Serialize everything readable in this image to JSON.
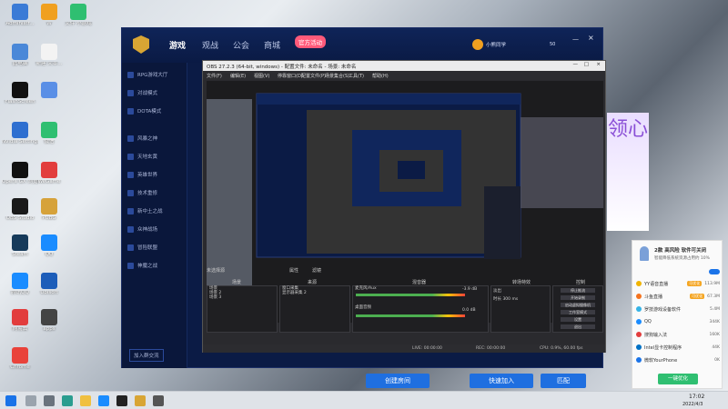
{
  "desktop": {
    "icons": [
      {
        "label": "Administr...",
        "icon": "computer-icon",
        "color": "#3b7bd6"
      },
      {
        "label": "W",
        "icon": "owl-icon",
        "color": "#f0a020"
      },
      {
        "label": "文件 小游戏",
        "icon": "wechat-icon",
        "color": "#2fbf71"
      },
      {
        "label": "此电脑",
        "icon": "pc-icon",
        "color": "#4a88d8"
      },
      {
        "label": "新建 文本...",
        "icon": "document-icon",
        "color": "#f3f3f3"
      },
      {
        "label": "FlashScreen",
        "icon": "screen-icon",
        "color": "#111111"
      },
      {
        "label": "",
        "icon": "folder-icon",
        "color": "#5a8fe6"
      },
      {
        "label": "Nvidia Settings",
        "icon": "nvidia-icon",
        "color": "#2e6fd0"
      },
      {
        "label": "微信",
        "icon": "wechat-green-icon",
        "color": "#2fbf71"
      },
      {
        "label": "Opera GX 浏览器",
        "icon": "opera-icon",
        "color": "#111111"
      },
      {
        "label": "WeGame",
        "icon": "wegame-icon",
        "color": "#e23d3d"
      },
      {
        "label": "OBS Studio",
        "icon": "obs-icon",
        "color": "#1a1a1a"
      },
      {
        "label": "PUBG",
        "icon": "pubg-icon",
        "color": "#d6a23a"
      },
      {
        "label": "Steam",
        "icon": "steam-icon",
        "color": "#163a5a"
      },
      {
        "label": "QQ",
        "icon": "qq-icon",
        "color": "#1a8cff"
      },
      {
        "label": "腾讯QQ",
        "icon": "qq2-icon",
        "color": "#1a8cff"
      },
      {
        "label": "Ubisoft",
        "icon": "ubisoft-icon",
        "color": "#1c5db9"
      },
      {
        "label": "网易云",
        "icon": "music-icon",
        "color": "#e23d3d"
      },
      {
        "label": "apps",
        "icon": "app-icon",
        "color": "#444444"
      },
      {
        "label": "Chrome",
        "icon": "chrome-icon",
        "color": "#e9423a"
      }
    ]
  },
  "game_client": {
    "logo": "game-logo-icon",
    "nav": [
      "游戏",
      "观战",
      "公会",
      "商城"
    ],
    "badge": "官方活动",
    "user": "小熊同学",
    "coins": "50",
    "sidebar": [
      "RPG游戏大厅",
      "对战模式",
      "DOTA模式",
      "风暴之神",
      "天地玄黄",
      "英雄世界",
      "技术重修",
      "新中土之战",
      "众神战场",
      "冒险联盟",
      "神魔之战"
    ],
    "bottom_tag": "加入群交流",
    "buttons": [
      "创建房间",
      "快速加入",
      "匹配"
    ]
  },
  "obs": {
    "title": "OBS 27.2.3 (64-bit, windows) - 配置文件: 未命名 - 场景: 未命名",
    "menu": [
      "文件(F)",
      "编辑(E)",
      "视图(V)",
      "停靠窗口(D)",
      "配置文件(P)",
      "场景集合(S)",
      "工具(T)",
      "帮助(H)"
    ],
    "toolbar": {
      "label": "未选择源",
      "props": "属性",
      "filters": "滤镜"
    },
    "docks": {
      "scenes": "场景",
      "sources": "来源",
      "mixer": "混音器",
      "transitions": "转场特效",
      "controls": "控制"
    },
    "scenes": [
      "场景",
      "场景 2",
      "场景 3"
    ],
    "sources": [
      "窗口采集",
      "显示器采集 2"
    ],
    "mixer": [
      {
        "name": "桌面音频",
        "db": "0.0 dB"
      },
      {
        "name": "麦克风/Aux",
        "db": "-3.9 dB"
      }
    ],
    "transitions": {
      "type": "淡出",
      "duration_label": "时长",
      "duration": "300 ms"
    },
    "controls": [
      "停止推流",
      "开始录制",
      "启动虚拟摄像机",
      "工作室模式",
      "设置",
      "退出"
    ],
    "status": {
      "live": "LIVE: 00:00:00",
      "rec": "REC: 00:00:00",
      "cpu": "CPU: 0.9%, 60.00 fps"
    }
  },
  "ad": {
    "text": "领心"
  },
  "notification": {
    "title": "2款 高风险 软件可关闭",
    "subtitle": "智能降低系统资源占用约 10%",
    "rows": [
      {
        "name": "YY语音直播",
        "size": "113.9M",
        "color": "#f0b400",
        "badge": "可优化"
      },
      {
        "name": "斗鱼直播",
        "size": "67.3M",
        "color": "#f5731f",
        "badge": "可优化"
      },
      {
        "name": "罗技游戏设备软件",
        "size": "5.4M",
        "color": "#35b3e6"
      },
      {
        "name": "QQ",
        "size": "344K",
        "color": "#1a8cff"
      },
      {
        "name": "搜狗输入法",
        "size": "160K",
        "color": "#e23d3d"
      },
      {
        "name": "Intel显卡控制程序",
        "size": "44K",
        "color": "#0071c5"
      },
      {
        "name": "微软YourPhone",
        "size": "0K",
        "color": "#1a73e8"
      }
    ],
    "button": "一键优化"
  },
  "taskbar": {
    "time": "17:02",
    "date": "2022/4/3"
  }
}
